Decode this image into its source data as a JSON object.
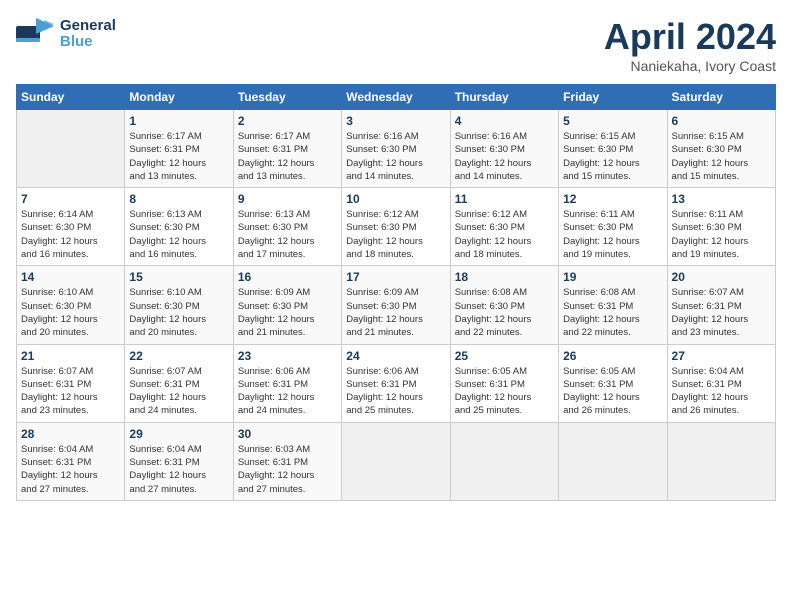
{
  "header": {
    "logo_line1": "General",
    "logo_line2": "Blue",
    "month": "April 2024",
    "location": "Naniekaha, Ivory Coast"
  },
  "weekdays": [
    "Sunday",
    "Monday",
    "Tuesday",
    "Wednesday",
    "Thursday",
    "Friday",
    "Saturday"
  ],
  "weeks": [
    [
      {
        "day": "",
        "info": ""
      },
      {
        "day": "1",
        "info": "Sunrise: 6:17 AM\nSunset: 6:31 PM\nDaylight: 12 hours\nand 13 minutes."
      },
      {
        "day": "2",
        "info": "Sunrise: 6:17 AM\nSunset: 6:31 PM\nDaylight: 12 hours\nand 13 minutes."
      },
      {
        "day": "3",
        "info": "Sunrise: 6:16 AM\nSunset: 6:30 PM\nDaylight: 12 hours\nand 14 minutes."
      },
      {
        "day": "4",
        "info": "Sunrise: 6:16 AM\nSunset: 6:30 PM\nDaylight: 12 hours\nand 14 minutes."
      },
      {
        "day": "5",
        "info": "Sunrise: 6:15 AM\nSunset: 6:30 PM\nDaylight: 12 hours\nand 15 minutes."
      },
      {
        "day": "6",
        "info": "Sunrise: 6:15 AM\nSunset: 6:30 PM\nDaylight: 12 hours\nand 15 minutes."
      }
    ],
    [
      {
        "day": "7",
        "info": "Sunrise: 6:14 AM\nSunset: 6:30 PM\nDaylight: 12 hours\nand 16 minutes."
      },
      {
        "day": "8",
        "info": "Sunrise: 6:13 AM\nSunset: 6:30 PM\nDaylight: 12 hours\nand 16 minutes."
      },
      {
        "day": "9",
        "info": "Sunrise: 6:13 AM\nSunset: 6:30 PM\nDaylight: 12 hours\nand 17 minutes."
      },
      {
        "day": "10",
        "info": "Sunrise: 6:12 AM\nSunset: 6:30 PM\nDaylight: 12 hours\nand 18 minutes."
      },
      {
        "day": "11",
        "info": "Sunrise: 6:12 AM\nSunset: 6:30 PM\nDaylight: 12 hours\nand 18 minutes."
      },
      {
        "day": "12",
        "info": "Sunrise: 6:11 AM\nSunset: 6:30 PM\nDaylight: 12 hours\nand 19 minutes."
      },
      {
        "day": "13",
        "info": "Sunrise: 6:11 AM\nSunset: 6:30 PM\nDaylight: 12 hours\nand 19 minutes."
      }
    ],
    [
      {
        "day": "14",
        "info": "Sunrise: 6:10 AM\nSunset: 6:30 PM\nDaylight: 12 hours\nand 20 minutes."
      },
      {
        "day": "15",
        "info": "Sunrise: 6:10 AM\nSunset: 6:30 PM\nDaylight: 12 hours\nand 20 minutes."
      },
      {
        "day": "16",
        "info": "Sunrise: 6:09 AM\nSunset: 6:30 PM\nDaylight: 12 hours\nand 21 minutes."
      },
      {
        "day": "17",
        "info": "Sunrise: 6:09 AM\nSunset: 6:30 PM\nDaylight: 12 hours\nand 21 minutes."
      },
      {
        "day": "18",
        "info": "Sunrise: 6:08 AM\nSunset: 6:30 PM\nDaylight: 12 hours\nand 22 minutes."
      },
      {
        "day": "19",
        "info": "Sunrise: 6:08 AM\nSunset: 6:31 PM\nDaylight: 12 hours\nand 22 minutes."
      },
      {
        "day": "20",
        "info": "Sunrise: 6:07 AM\nSunset: 6:31 PM\nDaylight: 12 hours\nand 23 minutes."
      }
    ],
    [
      {
        "day": "21",
        "info": "Sunrise: 6:07 AM\nSunset: 6:31 PM\nDaylight: 12 hours\nand 23 minutes."
      },
      {
        "day": "22",
        "info": "Sunrise: 6:07 AM\nSunset: 6:31 PM\nDaylight: 12 hours\nand 24 minutes."
      },
      {
        "day": "23",
        "info": "Sunrise: 6:06 AM\nSunset: 6:31 PM\nDaylight: 12 hours\nand 24 minutes."
      },
      {
        "day": "24",
        "info": "Sunrise: 6:06 AM\nSunset: 6:31 PM\nDaylight: 12 hours\nand 25 minutes."
      },
      {
        "day": "25",
        "info": "Sunrise: 6:05 AM\nSunset: 6:31 PM\nDaylight: 12 hours\nand 25 minutes."
      },
      {
        "day": "26",
        "info": "Sunrise: 6:05 AM\nSunset: 6:31 PM\nDaylight: 12 hours\nand 26 minutes."
      },
      {
        "day": "27",
        "info": "Sunrise: 6:04 AM\nSunset: 6:31 PM\nDaylight: 12 hours\nand 26 minutes."
      }
    ],
    [
      {
        "day": "28",
        "info": "Sunrise: 6:04 AM\nSunset: 6:31 PM\nDaylight: 12 hours\nand 27 minutes."
      },
      {
        "day": "29",
        "info": "Sunrise: 6:04 AM\nSunset: 6:31 PM\nDaylight: 12 hours\nand 27 minutes."
      },
      {
        "day": "30",
        "info": "Sunrise: 6:03 AM\nSunset: 6:31 PM\nDaylight: 12 hours\nand 27 minutes."
      },
      {
        "day": "",
        "info": ""
      },
      {
        "day": "",
        "info": ""
      },
      {
        "day": "",
        "info": ""
      },
      {
        "day": "",
        "info": ""
      }
    ]
  ]
}
